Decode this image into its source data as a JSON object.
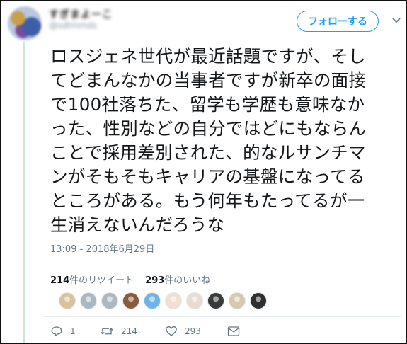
{
  "user": {
    "display_name": "すぎまよーこ",
    "handle": "@sdtmmds"
  },
  "header": {
    "follow_label": "フォローする"
  },
  "tweet": {
    "text": "ロスジェネ世代が最近話題ですが、そし\nてどまんなかの当事者ですが新卒の面接\nで100社落ちた、留学も学歴も意味なか\nった、性別などの自分ではどにもならん\nことで採用差別された、的なルサンチマ\nンがそもそもキャリアの基盤になってる\nところがある。もう何年もたってるが一\n生消えないんだろうな",
    "timestamp": "13:09 - 2018年6月29日"
  },
  "stats": {
    "retweet_count": "214",
    "retweet_label": "件のリツイート",
    "like_count": "293",
    "like_label": "件のいいね"
  },
  "likers": [
    "#d8c39a",
    "#aab8c2",
    "#aab8c2",
    "#8a5a3a",
    "#6fb3e8",
    "#f0e0d0",
    "#e8dcd0",
    "#3a3a3a",
    "#d9c7b0",
    "#2f2f2f"
  ],
  "actions": {
    "reply_count": "1",
    "retweet_count": "214",
    "like_count": "293"
  },
  "colors": {
    "accent": "#1da1f2",
    "muted": "#657786",
    "thread_bar": "#c9e8d3"
  }
}
